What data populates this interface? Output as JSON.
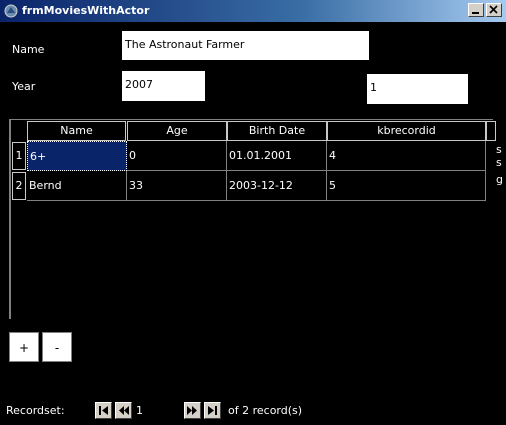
{
  "window": {
    "title": "frmMoviesWithActor"
  },
  "form": {
    "name_label": "Name",
    "name_value": "The Astronaut Farmer",
    "year_label": "Year",
    "year_value": "2007",
    "id_value": "1"
  },
  "grid": {
    "columns": [
      "Name",
      "Age",
      "Birth Date",
      "kbrecordid"
    ],
    "rows": [
      {
        "indicator": "1",
        "name": "6+",
        "age": "0",
        "birth_date": "01.01.2001",
        "kbrecordid": "4"
      },
      {
        "indicator": "2",
        "name": "Bernd",
        "age": "33",
        "birth_date": "2003-12-12",
        "kbrecordid": "5"
      }
    ],
    "overflow_chars": [
      "s",
      "s",
      "g"
    ]
  },
  "buttons": {
    "add_label": "+",
    "remove_label": "-"
  },
  "navigator": {
    "label": "Recordset:",
    "current": "1",
    "total_text": "of 2 record(s)"
  }
}
